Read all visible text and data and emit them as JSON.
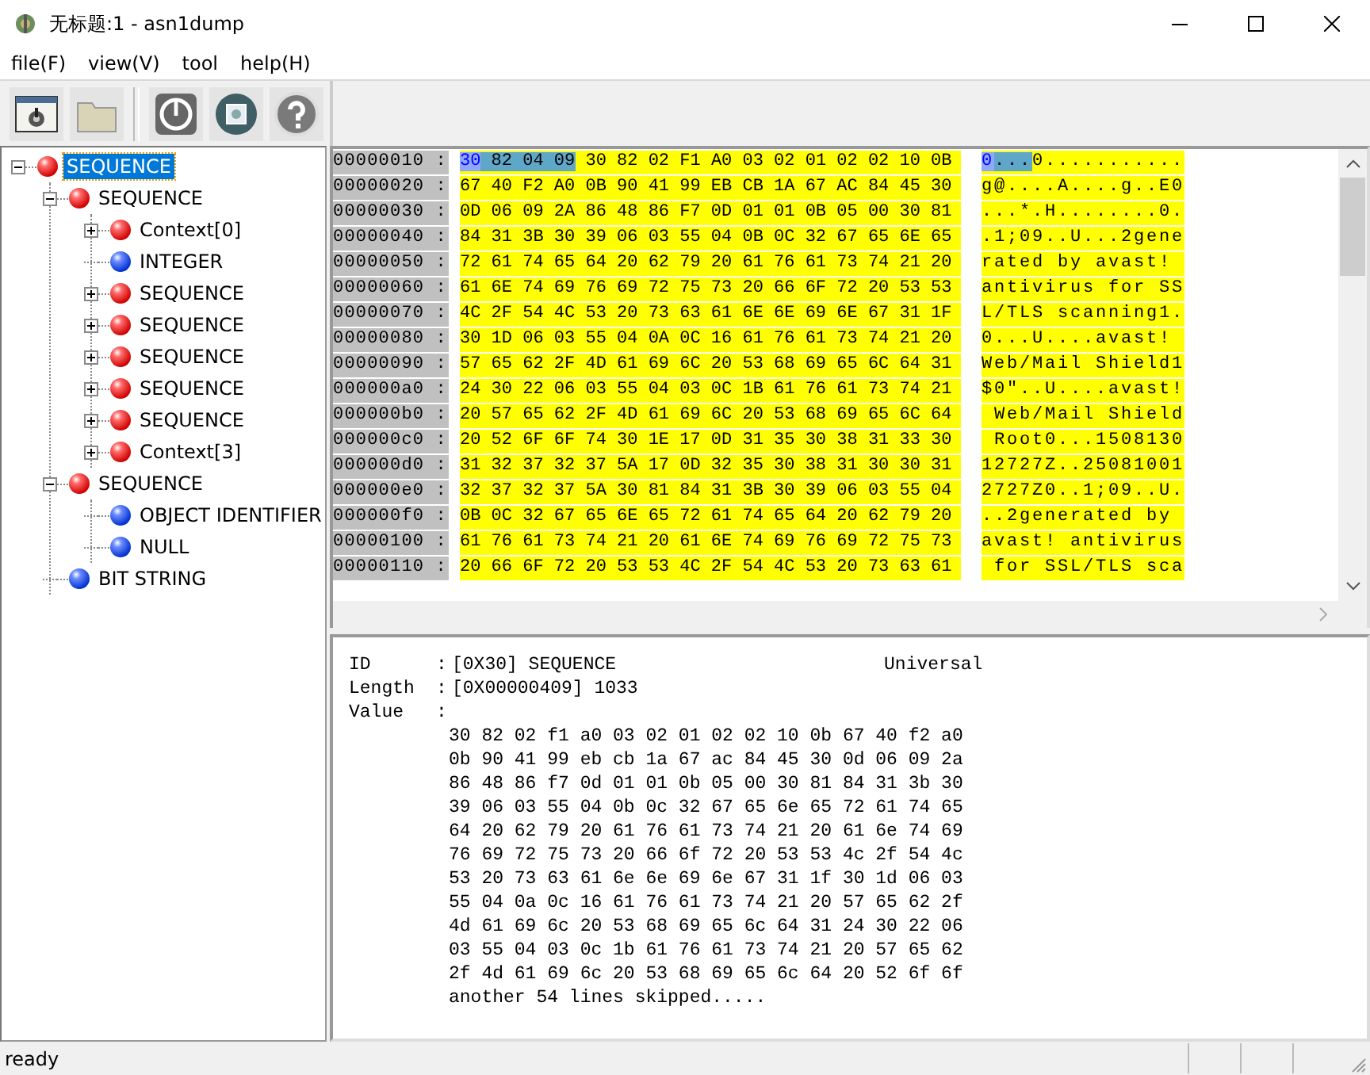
{
  "window": {
    "title": "无标题:1 - asn1dump"
  },
  "menu": [
    "file(F)",
    "view(V)",
    "tool",
    "help(H)"
  ],
  "toolbar": [
    {
      "kind": "window-gear"
    },
    {
      "kind": "folder"
    },
    {
      "kind": "separator"
    },
    {
      "kind": "power"
    },
    {
      "kind": "globe-picture"
    },
    {
      "kind": "help"
    }
  ],
  "tree": [
    {
      "label": "SEQUENCE",
      "kind": "constructed",
      "selected": true,
      "expanded": true,
      "children": [
        {
          "label": "SEQUENCE",
          "kind": "constructed",
          "selected": false,
          "expanded": true,
          "children": [
            {
              "label": "Context[0]",
              "kind": "constructed",
              "selected": false,
              "expanded": false
            },
            {
              "label": "INTEGER",
              "kind": "primitive",
              "selected": false
            },
            {
              "label": "SEQUENCE",
              "kind": "constructed",
              "selected": false,
              "expanded": false
            },
            {
              "label": "SEQUENCE",
              "kind": "constructed",
              "selected": false,
              "expanded": false
            },
            {
              "label": "SEQUENCE",
              "kind": "constructed",
              "selected": false,
              "expanded": false
            },
            {
              "label": "SEQUENCE",
              "kind": "constructed",
              "selected": false,
              "expanded": false
            },
            {
              "label": "SEQUENCE",
              "kind": "constructed",
              "selected": false,
              "expanded": false
            },
            {
              "label": "Context[3]",
              "kind": "constructed",
              "selected": false,
              "expanded": false
            }
          ]
        },
        {
          "label": "SEQUENCE",
          "kind": "constructed",
          "selected": false,
          "expanded": true,
          "children": [
            {
              "label": "OBJECT IDENTIFIER",
              "kind": "primitive",
              "selected": false
            },
            {
              "label": "NULL",
              "kind": "primitive",
              "selected": false
            }
          ]
        },
        {
          "label": "BIT STRING",
          "kind": "primitive",
          "selected": false
        }
      ]
    }
  ],
  "hex_rows": [
    {
      "offset": "00000010 :",
      "hex": [
        {
          "text": "30",
          "kind": "tag"
        },
        {
          "text": " 82 04 09",
          "kind": "length"
        },
        {
          "text": " 30 82 02 F1 A0 03 02 01 02 02 10 0B",
          "kind": "value"
        }
      ],
      "ascii": [
        {
          "text": "0",
          "kind": "tag"
        },
        {
          "text": "...",
          "kind": "length"
        },
        {
          "text": "0...........",
          "kind": "value"
        }
      ]
    },
    {
      "offset": "00000020 :",
      "hex": [
        {
          "text": "67 40 F2 A0 0B 90 41 99 EB CB 1A 67 AC 84 45 30",
          "kind": "value"
        }
      ],
      "ascii": [
        {
          "text": "g@....A....g..E0",
          "kind": "value"
        }
      ]
    },
    {
      "offset": "00000030 :",
      "hex": [
        {
          "text": "0D 06 09 2A 86 48 86 F7 0D 01 01 0B 05 00 30 81",
          "kind": "value"
        }
      ],
      "ascii": [
        {
          "text": "...*.H........0.",
          "kind": "value"
        }
      ]
    },
    {
      "offset": "00000040 :",
      "hex": [
        {
          "text": "84 31 3B 30 39 06 03 55 04 0B 0C 32 67 65 6E 65",
          "kind": "value"
        }
      ],
      "ascii": [
        {
          "text": ".1;09..U...2gene",
          "kind": "value"
        }
      ]
    },
    {
      "offset": "00000050 :",
      "hex": [
        {
          "text": "72 61 74 65 64 20 62 79 20 61 76 61 73 74 21 20",
          "kind": "value"
        }
      ],
      "ascii": [
        {
          "text": "rated by avast! ",
          "kind": "value"
        }
      ]
    },
    {
      "offset": "00000060 :",
      "hex": [
        {
          "text": "61 6E 74 69 76 69 72 75 73 20 66 6F 72 20 53 53",
          "kind": "value"
        }
      ],
      "ascii": [
        {
          "text": "antivirus for SS",
          "kind": "value"
        }
      ]
    },
    {
      "offset": "00000070 :",
      "hex": [
        {
          "text": "4C 2F 54 4C 53 20 73 63 61 6E 6E 69 6E 67 31 1F",
          "kind": "value"
        }
      ],
      "ascii": [
        {
          "text": "L/TLS scanning1.",
          "kind": "value"
        }
      ]
    },
    {
      "offset": "00000080 :",
      "hex": [
        {
          "text": "30 1D 06 03 55 04 0A 0C 16 61 76 61 73 74 21 20",
          "kind": "value"
        }
      ],
      "ascii": [
        {
          "text": "0...U....avast! ",
          "kind": "value"
        }
      ]
    },
    {
      "offset": "00000090 :",
      "hex": [
        {
          "text": "57 65 62 2F 4D 61 69 6C 20 53 68 69 65 6C 64 31",
          "kind": "value"
        }
      ],
      "ascii": [
        {
          "text": "Web/Mail Shield1",
          "kind": "value"
        }
      ]
    },
    {
      "offset": "000000a0 :",
      "hex": [
        {
          "text": "24 30 22 06 03 55 04 03 0C 1B 61 76 61 73 74 21",
          "kind": "value"
        }
      ],
      "ascii": [
        {
          "text": "$0\"..U....avast!",
          "kind": "value"
        }
      ]
    },
    {
      "offset": "000000b0 :",
      "hex": [
        {
          "text": "20 57 65 62 2F 4D 61 69 6C 20 53 68 69 65 6C 64",
          "kind": "value"
        }
      ],
      "ascii": [
        {
          "text": " Web/Mail Shield",
          "kind": "value"
        }
      ]
    },
    {
      "offset": "000000c0 :",
      "hex": [
        {
          "text": "20 52 6F 6F 74 30 1E 17 0D 31 35 30 38 31 33 30",
          "kind": "value"
        }
      ],
      "ascii": [
        {
          "text": " Root0...1508130",
          "kind": "value"
        }
      ]
    },
    {
      "offset": "000000d0 :",
      "hex": [
        {
          "text": "31 32 37 32 37 5A 17 0D 32 35 30 38 31 30 30 31",
          "kind": "value"
        }
      ],
      "ascii": [
        {
          "text": "12727Z..25081001",
          "kind": "value"
        }
      ]
    },
    {
      "offset": "000000e0 :",
      "hex": [
        {
          "text": "32 37 32 37 5A 30 81 84 31 3B 30 39 06 03 55 04",
          "kind": "value"
        }
      ],
      "ascii": [
        {
          "text": "2727Z0..1;09..U.",
          "kind": "value"
        }
      ]
    },
    {
      "offset": "000000f0 :",
      "hex": [
        {
          "text": "0B 0C 32 67 65 6E 65 72 61 74 65 64 20 62 79 20",
          "kind": "value"
        }
      ],
      "ascii": [
        {
          "text": "..2generated by ",
          "kind": "value"
        }
      ]
    },
    {
      "offset": "00000100 :",
      "hex": [
        {
          "text": "61 76 61 73 74 21 20 61 6E 74 69 76 69 72 75 73",
          "kind": "value"
        }
      ],
      "ascii": [
        {
          "text": "avast! antivirus",
          "kind": "value"
        }
      ]
    },
    {
      "offset": "00000110 :",
      "hex": [
        {
          "text": "20 66 6F 72 20 53 53 4C 2F 54 4C 53 20 73 63 61",
          "kind": "value"
        }
      ],
      "ascii": [
        {
          "text": " for SSL/TLS sca",
          "kind": "value"
        }
      ]
    }
  ],
  "detail": {
    "fields": [
      {
        "label": "ID",
        "separator": ":",
        "value": "[0X30] SEQUENCE",
        "class": "Universal"
      },
      {
        "label": "Length",
        "separator": ":",
        "value": "[0X00000409] 1033"
      },
      {
        "label": "Value",
        "separator": ":"
      }
    ],
    "value_lines": [
      "30 82 02 f1 a0 03 02 01 02 02 10 0b 67 40 f2 a0",
      "0b 90 41 99 eb cb 1a 67 ac 84 45 30 0d 06 09 2a",
      "86 48 86 f7 0d 01 01 0b 05 00 30 81 84 31 3b 30",
      "39 06 03 55 04 0b 0c 32 67 65 6e 65 72 61 74 65",
      "64 20 62 79 20 61 76 61 73 74 21 20 61 6e 74 69",
      "76 69 72 75 73 20 66 6f 72 20 53 53 4c 2f 54 4c",
      "53 20 73 63 61 6e 6e 69 6e 67 31 1f 30 1d 06 03",
      "55 04 0a 0c 16 61 76 61 73 74 21 20 57 65 62 2f",
      "4d 61 69 6c 20 53 68 69 65 6c 64 31 24 30 22 06",
      "03 55 04 03 0c 1b 61 76 61 73 74 21 20 57 65 62",
      "2f 4d 61 69 6c 20 53 68 69 65 6c 64 20 52 6f 6f"
    ],
    "note": "another 54 lines skipped....."
  },
  "status_bar": {
    "text": "ready"
  }
}
